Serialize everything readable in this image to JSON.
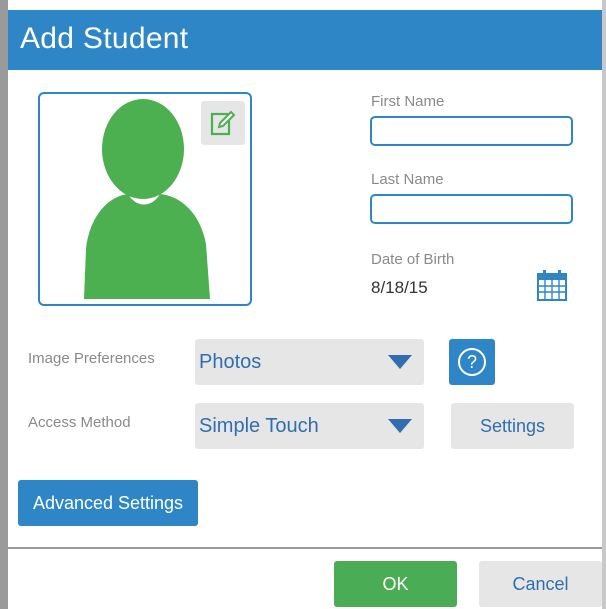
{
  "dialog": {
    "title": "Add Student"
  },
  "form": {
    "first_name": {
      "label": "First Name",
      "value": "",
      "placeholder": ""
    },
    "last_name": {
      "label": "Last Name",
      "value": "",
      "placeholder": ""
    },
    "dob": {
      "label": "Date of Birth",
      "value": "8/18/15"
    }
  },
  "preferences": {
    "image": {
      "label": "Image Preferences",
      "selected": "Photos"
    },
    "access": {
      "label": "Access Method",
      "selected": "Simple Touch"
    },
    "help_symbol": "?",
    "settings_label": "Settings"
  },
  "buttons": {
    "advanced": "Advanced Settings",
    "ok": "OK",
    "cancel": "Cancel"
  },
  "icons": {
    "avatar": "person-silhouette-icon",
    "edit": "edit-icon",
    "calendar": "calendar-icon",
    "dropdown": "triangle-down-icon"
  },
  "colors": {
    "accent": "#2f86c7",
    "avatar": "#4caf50",
    "ok": "#4aac54",
    "button_gray": "#e6e6e6",
    "label_gray": "#8a8a8a"
  }
}
